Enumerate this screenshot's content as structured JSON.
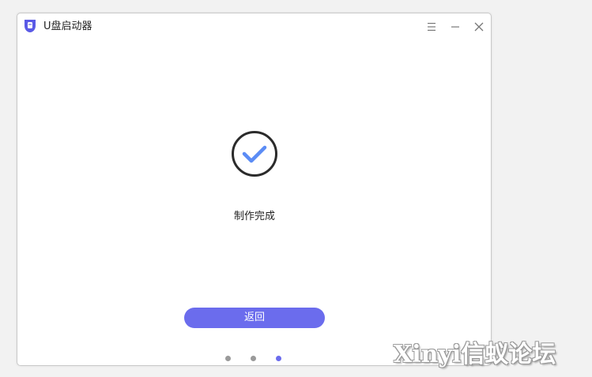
{
  "window": {
    "title": "U盘启动器"
  },
  "titlebar": {
    "menu_icon": "hamburger-menu-icon",
    "minimize_icon": "minimize-icon",
    "close_icon": "close-icon"
  },
  "main": {
    "status_icon": "check-circle-icon",
    "status_text": "制作完成",
    "back_label": "返回"
  },
  "pager": {
    "total_steps": 3,
    "current_step": 3
  },
  "watermark": {
    "text": "Xinyi信蚁论坛"
  },
  "colors": {
    "accent": "#6b6ced",
    "check": "#5b8cf5",
    "circle": "#2b2b2b",
    "dot_inactive": "#9a9a9a"
  }
}
